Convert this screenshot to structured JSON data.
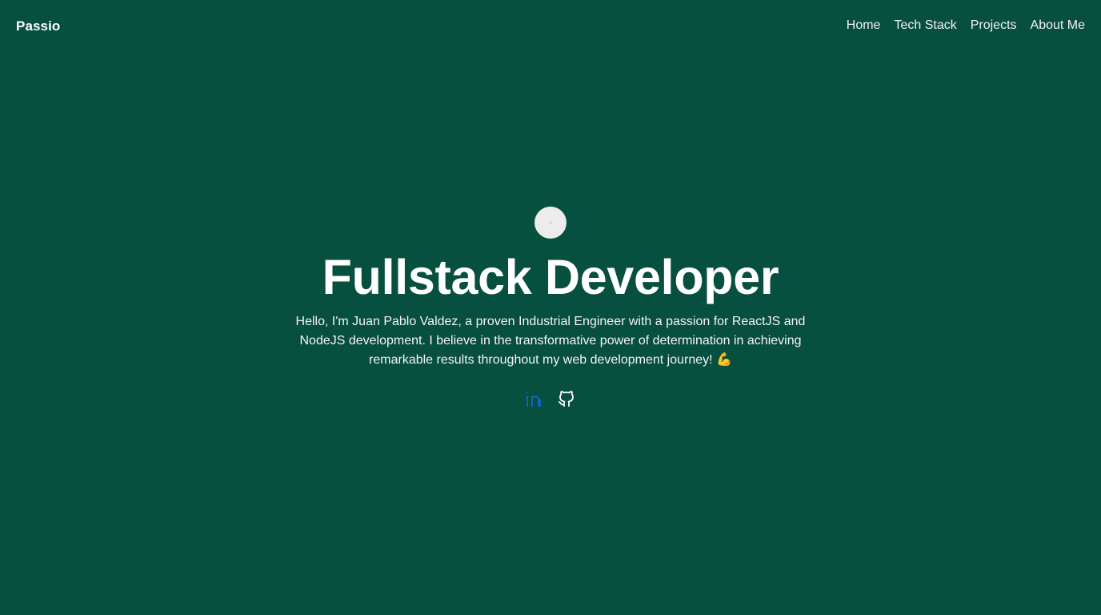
{
  "navbar": {
    "brand": "Passio",
    "links": [
      "Home",
      "Tech Stack",
      "Projects",
      "About Me"
    ]
  },
  "hero": {
    "title": "Fullstack Developer",
    "description": "Hello, I'm Juan Pablo Valdez, a proven Industrial Engineer with a passion for ReactJS and NodeJS development. I believe in the transformative power of determination in achieving remarkable results throughout my web development journey! 💪",
    "avatar_icon": "avatar-placeholder",
    "socials": [
      {
        "icon": "linkedin-icon",
        "color": "#0a66c2"
      },
      {
        "icon": "github-icon",
        "color": "#ffffff"
      }
    ]
  },
  "colors": {
    "background": "#074f3e",
    "text": "#ffffff",
    "linkedin": "#0a66c2"
  }
}
